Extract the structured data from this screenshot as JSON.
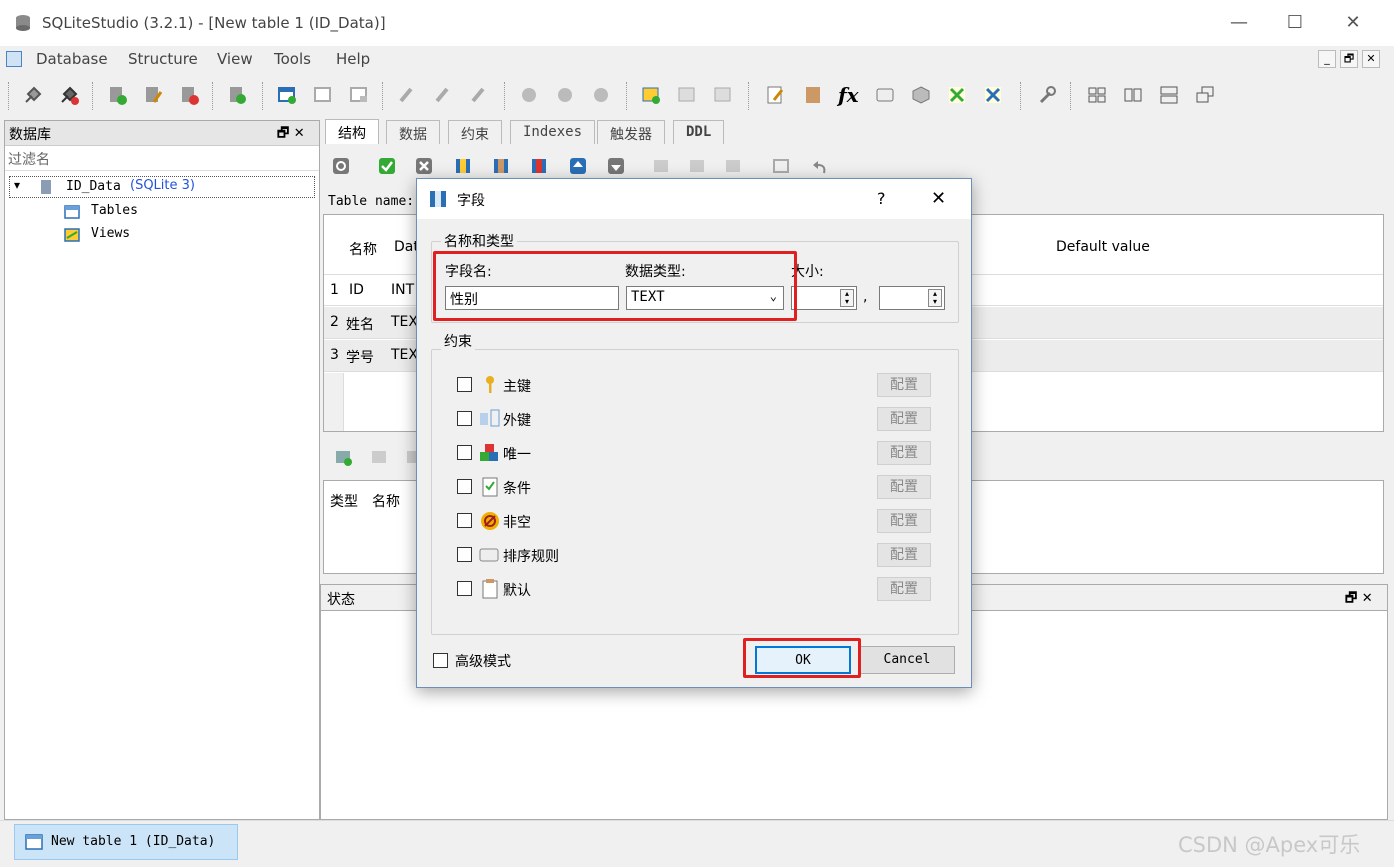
{
  "window": {
    "title": "SQLiteStudio (3.2.1) - [New table 1 (ID_Data)]",
    "minimize": "—",
    "maximize": "☐",
    "close": "✕"
  },
  "menubar": {
    "items": [
      "Database",
      "Structure",
      "View",
      "Tools",
      "Help"
    ],
    "mdi_controls": [
      "_",
      "🗗",
      "✕"
    ]
  },
  "leftpanel": {
    "title": "数据库",
    "filter_placeholder": "过滤名",
    "tree": {
      "database": "ID_Data",
      "database_type": "(SQLite 3)",
      "children": [
        "Tables",
        "Views"
      ]
    },
    "dock_controls": "🗗 ✕"
  },
  "tabs": [
    "结构",
    "数据",
    "约束",
    "Indexes",
    "触发器",
    "DDL"
  ],
  "structure": {
    "table_name_label": "Table name:",
    "columns_header": [
      "名称",
      "Dat"
    ],
    "default_value_header": "Default value",
    "rows": [
      {
        "num": "1",
        "name": "ID",
        "type": "INT"
      },
      {
        "num": "2",
        "name": "姓名",
        "type": "TEX"
      },
      {
        "num": "3",
        "name": "学号",
        "type": "TEX"
      }
    ],
    "constraints_header": [
      "类型",
      "名称"
    ]
  },
  "status": {
    "title": "状态",
    "controls": "🗗 ✕"
  },
  "taskbar": {
    "task_label": "New table 1 (ID_Data)",
    "watermark": "CSDN @Apex可乐"
  },
  "dialog": {
    "title": "字段",
    "help": "?",
    "close": "✕",
    "group_name_type": "名称和类型",
    "field_name_label": "字段名:",
    "data_type_label": "数据类型:",
    "size_label": "大小:",
    "field_name_value": "性别",
    "data_type_value": "TEXT",
    "size_sep": ",",
    "group_constraints": "约束",
    "constraints": [
      {
        "label": "主键",
        "icon": "key-icon",
        "config": "配置"
      },
      {
        "label": "外键",
        "icon": "foreign-key-icon",
        "config": "配置"
      },
      {
        "label": "唯一",
        "icon": "unique-icon",
        "config": "配置"
      },
      {
        "label": "条件",
        "icon": "check-icon",
        "config": "配置"
      },
      {
        "label": "非空",
        "icon": "not-null-icon",
        "config": "配置"
      },
      {
        "label": "排序规则",
        "icon": "collation-icon",
        "config": "配置"
      },
      {
        "label": "默认",
        "icon": "default-icon",
        "config": "配置"
      }
    ],
    "advanced_mode": "高级模式",
    "ok": "OK",
    "cancel": "Cancel"
  }
}
